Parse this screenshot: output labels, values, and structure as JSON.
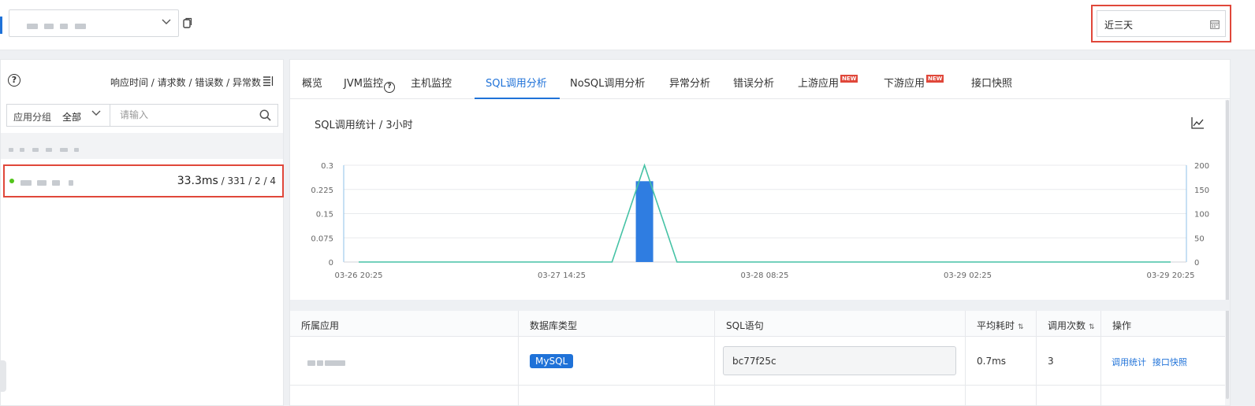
{
  "topbar": {
    "app_select": {
      "chevron_icon": "chevron-down-icon"
    },
    "date_range": {
      "value": "近三天",
      "icon": "calendar-icon"
    }
  },
  "left_panel": {
    "header": {
      "metrics_label": "响应时间 / 请求数 / 错误数 / 异常数"
    },
    "filter": {
      "group_label": "应用分组",
      "group_value": "全部",
      "search_placeholder": "请输入"
    },
    "apps": [
      {
        "status_color": "#52c41a",
        "response_time": "33.3ms",
        "counts": " / 331 / 2 / 4"
      }
    ]
  },
  "tabs": [
    {
      "label": "概览"
    },
    {
      "label": "JVM监控"
    },
    {
      "label": "主机监控"
    },
    {
      "label": "SQL调用分析",
      "active": true
    },
    {
      "label": "NoSQL调用分析"
    },
    {
      "label": "异常分析"
    },
    {
      "label": "错误分析"
    },
    {
      "label": "上游应用",
      "badge": "NEW"
    },
    {
      "label": "下游应用",
      "badge": "NEW"
    },
    {
      "label": "接口快照"
    }
  ],
  "chart": {
    "title": "SQL调用统计 / 3小时"
  },
  "chart_data": {
    "type": "bar",
    "title": "SQL调用统计 / 3小时",
    "x_ticks": [
      "03-26 20:25",
      "03-27 14:25",
      "03-28 08:25",
      "03-29 02:25",
      "03-29 20:25"
    ],
    "y_left": {
      "ticks": [
        "0",
        "0.075",
        "0.15",
        "0.225",
        "0.3"
      ],
      "ylim": [
        0,
        0.3
      ]
    },
    "y_right": {
      "ticks": [
        "0",
        "50",
        "100",
        "150",
        "200"
      ],
      "ylim": [
        0,
        200
      ]
    },
    "series": [
      {
        "type": "bar",
        "axis": "right",
        "color": "#2f7de1",
        "points": [
          {
            "x": 0.352,
            "y": 167
          }
        ]
      },
      {
        "type": "line",
        "axis": "left",
        "color": "#45c2a5",
        "points": [
          {
            "x": 0.0,
            "y": 0
          },
          {
            "x": 0.312,
            "y": 0
          },
          {
            "x": 0.352,
            "y": 0.3
          },
          {
            "x": 0.392,
            "y": 0
          },
          {
            "x": 1.0,
            "y": 0
          }
        ]
      }
    ],
    "grid": true
  },
  "table": {
    "headers": {
      "app": "所属应用",
      "db_type": "数据库类型",
      "sql": "SQL语句",
      "avg_time": "平均耗时",
      "calls": "调用次数",
      "actions": "操作"
    },
    "rows": [
      {
        "db_type": "MySQL",
        "sql": "bc77f25c",
        "avg_time": "0.7ms",
        "calls": "3",
        "action_stats": "调用统计",
        "action_snapshot": "接口快照"
      }
    ]
  }
}
